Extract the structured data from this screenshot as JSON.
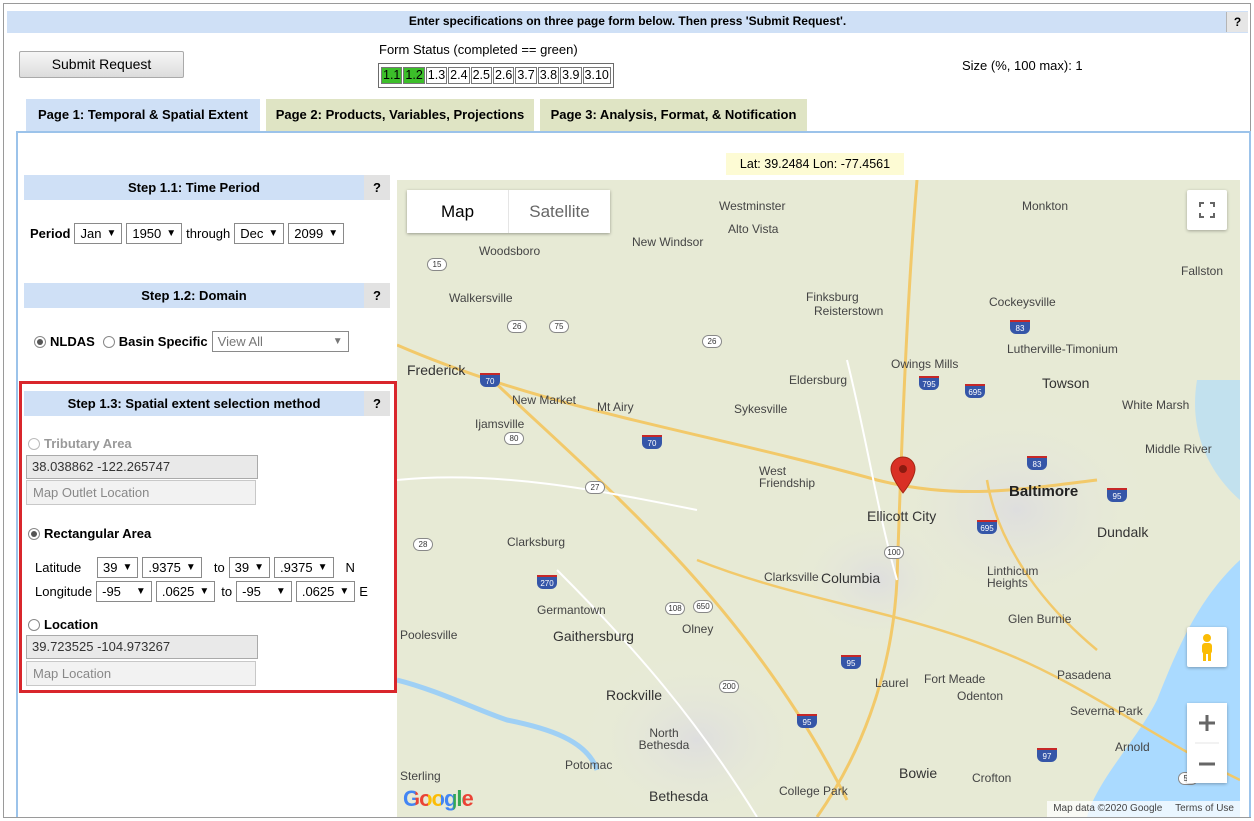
{
  "header": {
    "message": "Enter specifications on three page form below. Then press 'Submit Request'.",
    "help": "?"
  },
  "submit_label": "Submit Request",
  "form_status": {
    "label": "Form Status (completed == green)",
    "boxes": [
      {
        "label": "1.1",
        "done": true
      },
      {
        "label": "1.2",
        "done": true
      },
      {
        "label": "1.3",
        "done": false
      },
      {
        "label": "2.4",
        "done": false
      },
      {
        "label": "2.5",
        "done": false
      },
      {
        "label": "2.6",
        "done": false
      },
      {
        "label": "3.7",
        "done": false
      },
      {
        "label": "3.8",
        "done": false
      },
      {
        "label": "3.9",
        "done": false
      },
      {
        "label": "3.10",
        "done": false
      }
    ]
  },
  "size_text": "Size (%, 100 max): 1",
  "tabs": [
    "Page 1: Temporal & Spatial Extent",
    "Page 2: Products, Variables, Projections",
    "Page 3: Analysis, Format, & Notification"
  ],
  "coord_readout": "Lat: 39.2484 Lon: -77.4561",
  "step1": {
    "title": "Step 1.1: Time Period",
    "help": "?",
    "period_label": "Period",
    "start_month": "Jan",
    "start_year": "1950",
    "through": "through",
    "end_month": "Dec",
    "end_year": "2099"
  },
  "step2": {
    "title": "Step 1.2: Domain",
    "help": "?",
    "opt1": "NLDAS",
    "opt2": "Basin Specific",
    "basin_value": "View All"
  },
  "step3": {
    "title": "Step 1.3: Spatial extent selection method",
    "help": "?",
    "tributary_label": "Tributary Area",
    "tributary_coords": "38.038862 -122.265747",
    "tributary_button": "Map Outlet Location",
    "rect_label": "Rectangular Area",
    "lat_label": "Latitude",
    "lat_from_deg": "39",
    "lat_from_frac": ".9375",
    "lat_to": "to",
    "lat_to_deg": "39",
    "lat_to_frac": ".9375",
    "lat_dir": "N",
    "lon_label": "Longitude",
    "lon_from_deg": "-95",
    "lon_from_frac": ".0625",
    "lon_to": "to",
    "lon_to_deg": "-95",
    "lon_to_frac": ".0625",
    "lon_dir": "E",
    "location_label": "Location",
    "location_coords": "39.723525 -104.973267",
    "location_button": "Map Location"
  },
  "map": {
    "type_map": "Map",
    "type_satellite": "Satellite",
    "attribution": "Map data ©2020 Google",
    "terms": "Terms of Use",
    "google": "Google",
    "places": [
      {
        "name": "Baltimore",
        "cls": "big"
      },
      {
        "name": "Ellicott City",
        "cls": "mid"
      },
      {
        "name": "Columbia",
        "cls": "mid"
      },
      {
        "name": "Frederick",
        "cls": "mid"
      },
      {
        "name": "Gaithersburg",
        "cls": "mid"
      },
      {
        "name": "Rockville",
        "cls": "mid"
      },
      {
        "name": "Bethesda",
        "cls": "mid"
      },
      {
        "name": "Towson",
        "cls": "mid"
      },
      {
        "name": "Dundalk",
        "cls": "mid"
      },
      {
        "name": "Westminster",
        "cls": ""
      },
      {
        "name": "Alto Vista",
        "cls": ""
      },
      {
        "name": "New Windsor",
        "cls": ""
      },
      {
        "name": "Woodsboro",
        "cls": ""
      },
      {
        "name": "Walkersville",
        "cls": ""
      },
      {
        "name": "Finksburg",
        "cls": ""
      },
      {
        "name": "Reisterstown",
        "cls": ""
      },
      {
        "name": "Cockeysville",
        "cls": ""
      },
      {
        "name": "Lutherville-Timonium",
        "cls": ""
      },
      {
        "name": "Owings Mills",
        "cls": ""
      },
      {
        "name": "Eldersburg",
        "cls": ""
      },
      {
        "name": "Sykesville",
        "cls": ""
      },
      {
        "name": "Mt Airy",
        "cls": ""
      },
      {
        "name": "New Market",
        "cls": ""
      },
      {
        "name": "Ijamsville",
        "cls": ""
      },
      {
        "name": "West Friendship",
        "cls": ""
      },
      {
        "name": "Clarksburg",
        "cls": ""
      },
      {
        "name": "Clarksville",
        "cls": ""
      },
      {
        "name": "Germantown",
        "cls": ""
      },
      {
        "name": "Olney",
        "cls": ""
      },
      {
        "name": "Poolesville",
        "cls": ""
      },
      {
        "name": "Laurel",
        "cls": ""
      },
      {
        "name": "Fort Meade",
        "cls": ""
      },
      {
        "name": "Pasadena",
        "cls": ""
      },
      {
        "name": "Odenton",
        "cls": ""
      },
      {
        "name": "Severna Park",
        "cls": ""
      },
      {
        "name": "Glen Burnie",
        "cls": ""
      },
      {
        "name": "Linthicum Heights",
        "cls": ""
      },
      {
        "name": "Middle River",
        "cls": ""
      },
      {
        "name": "White Marsh",
        "cls": ""
      },
      {
        "name": "Monkton",
        "cls": ""
      },
      {
        "name": "Fallston",
        "cls": ""
      },
      {
        "name": "North Bethesda",
        "cls": ""
      },
      {
        "name": "Potomac",
        "cls": ""
      },
      {
        "name": "Sterling",
        "cls": ""
      },
      {
        "name": "College Park",
        "cls": ""
      },
      {
        "name": "Bowie",
        "cls": ""
      },
      {
        "name": "Crofton",
        "cls": ""
      },
      {
        "name": "Arnold",
        "cls": ""
      }
    ]
  }
}
